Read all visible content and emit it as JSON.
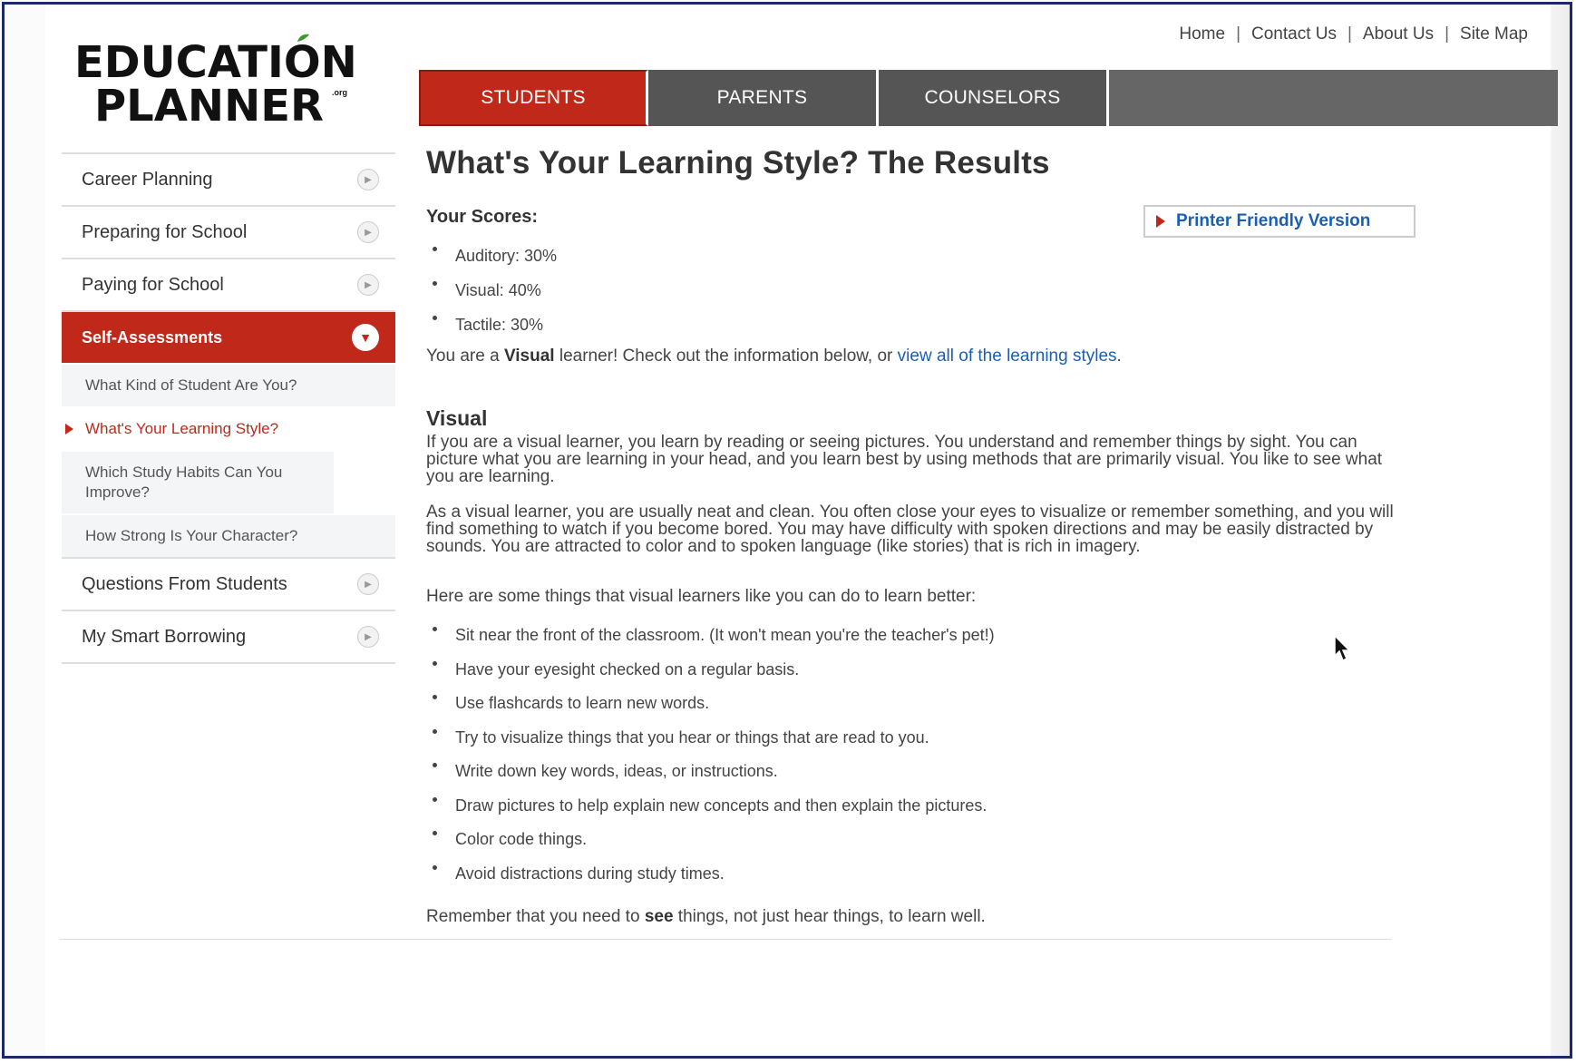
{
  "logo": {
    "line1": "EDUCATION",
    "line2": "PLANNER",
    "tag": ".org"
  },
  "top_links": [
    "Home",
    "Contact Us",
    "About Us",
    "Site Map"
  ],
  "tabs": [
    {
      "label": "STUDENTS",
      "active": true
    },
    {
      "label": "PARENTS",
      "active": false
    },
    {
      "label": "COUNSELORS",
      "active": false
    }
  ],
  "sidebar": {
    "items": [
      {
        "label": "Career Planning"
      },
      {
        "label": "Preparing for School"
      },
      {
        "label": "Paying for School"
      },
      {
        "label": "Self-Assessments"
      },
      {
        "label": "Questions From Students"
      },
      {
        "label": "My Smart Borrowing"
      }
    ],
    "sub_items": [
      {
        "label": "What Kind of Student Are You?"
      },
      {
        "label": "What's Your Learning Style?"
      },
      {
        "label": "Which Study Habits Can You Improve?"
      },
      {
        "label": "How Strong Is Your Character?"
      }
    ]
  },
  "main": {
    "title": "What's Your Learning Style? The Results",
    "scores_label": "Your Scores:",
    "printer_label": "Printer Friendly Version",
    "scores": [
      "Auditory: 30%",
      "Visual: 40%",
      "Tactile: 30%"
    ],
    "learner_prefix": "You are a ",
    "learner_type": "Visual",
    "learner_middle": " learner! Check out the information below, or ",
    "learner_link": "view all of the learning styles",
    "learner_suffix": ".",
    "section_title": "Visual",
    "para1": "If you are a visual learner, you learn by reading or seeing pictures. You understand and remember things by sight. You can picture what you are learning in your head, and you learn best by using methods that are primarily visual. You like to see what you are learning.",
    "para2": "As a visual learner, you are usually neat and clean. You often close your eyes to visualize or remember something, and you will find something to watch if you become bored. You may have difficulty with spoken directions and may be easily distracted by sounds. You are attracted to color and to spoken language (like stories) that is rich in imagery.",
    "para3": "Here are some things that visual learners like you can do to learn better:",
    "tips": [
      "Sit near the front of the classroom. (It won't mean you're the teacher's pet!)",
      "Have your eyesight checked on a regular basis.",
      "Use flashcards to learn new words.",
      "Try to visualize things that you hear or things that are read to you.",
      "Write down key words, ideas, or instructions.",
      "Draw pictures to help explain new concepts and then explain the pictures.",
      "Color code things.",
      "Avoid distractions during study times."
    ],
    "remember_prefix": "Remember that you need to ",
    "remember_bold": "see",
    "remember_suffix": " things, not just hear things, to learn well."
  },
  "colors": {
    "brand_red": "#c0281a",
    "tab_gray": "#555555",
    "link_blue": "#1b5fb3",
    "frame_border": "#1c2a6b"
  }
}
